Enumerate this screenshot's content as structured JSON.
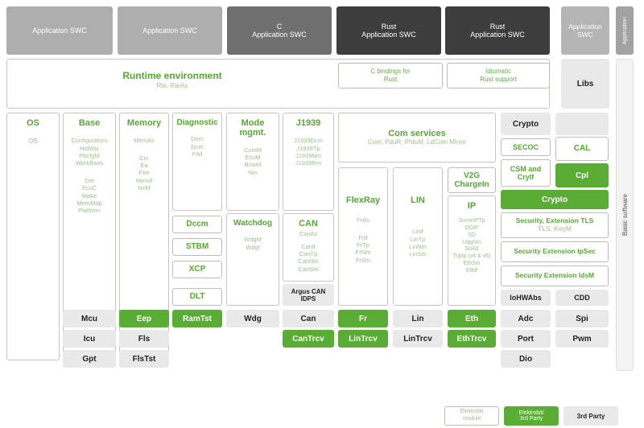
{
  "diagram": {
    "title": "Automotive software stack architecture",
    "colors": {
      "green": "#59ad34",
      "green_text": "#56a832",
      "grey_light": "#aeaeae",
      "grey_mid": "#6f6f6f",
      "grey_dark": "#3d3d3d",
      "panel_grey": "#e9e9e9"
    }
  },
  "application_layer": {
    "side_label": "Application",
    "swcs": [
      {
        "prefix": "",
        "label": "Application SWC",
        "tone": "light"
      },
      {
        "prefix": "",
        "label": "Application SWC",
        "tone": "light"
      },
      {
        "prefix": "C",
        "label": "Application SWC",
        "tone": "mid"
      },
      {
        "prefix": "Rust",
        "label": "Application SWC",
        "tone": "dark"
      },
      {
        "prefix": "Rust",
        "label": "Application SWC",
        "tone": "dark"
      },
      {
        "prefix": "",
        "label": "Application SWC",
        "tone": "small"
      }
    ]
  },
  "rte": {
    "title": "Runtime environment",
    "subtitle": "Rte, RteAs",
    "bindings": [
      {
        "line1": "C bindings for",
        "line2": "Rust"
      },
      {
        "line1": "Idiomatic",
        "line2": "Rust support"
      }
    ],
    "libs_label": "Libs"
  },
  "basic_software": {
    "side_label": "Basic software",
    "os": {
      "title": "OS",
      "items": [
        "OS"
      ]
    },
    "base": {
      "title": "Base",
      "group1": [
        "Configurators",
        "HidWiz",
        "PbcfgM",
        "Workflows"
      ],
      "group2": [
        "Det",
        "EcuC",
        "Make",
        "MemMap",
        "Platform"
      ]
    },
    "memory": {
      "title": "Memory",
      "group1": [
        "MemAs"
      ],
      "group2": [
        "Crc",
        "Ea",
        "Fee",
        "Memif",
        "NvM"
      ]
    },
    "diagnostic": {
      "title": "Diagnostic",
      "items": [
        "Dem",
        "Dcm",
        "FiM"
      ],
      "extras": [
        "Dccm",
        "STBM",
        "XCP",
        "DLT"
      ]
    },
    "mode_mgmt": {
      "title_line1": "Mode",
      "title_line2": "mgmt.",
      "items": [
        "ComM",
        "EcuM",
        "BswM",
        "Nm"
      ]
    },
    "watchdog": {
      "title": "Watchdog",
      "items": [
        "WdgM",
        "Wdgf"
      ]
    },
    "j1939": {
      "title": "J1939",
      "items": [
        "J1939Dcm",
        "J1939Tp",
        "J1939Nm",
        "J1939Rm"
      ]
    },
    "can": {
      "title": "CAN",
      "group1": [
        "CanAs"
      ],
      "group2": [
        "Canif",
        "CanTp",
        "CanNm",
        "CanSm"
      ],
      "footer_line1": "Argus CAN",
      "footer_line2": "IDPS"
    },
    "com_services": {
      "title": "Com services",
      "subtitle": "Com, PduR, IPduM, LdCom Mirror"
    },
    "flexray": {
      "title": "FlexRay",
      "group1": [
        "FrAs"
      ],
      "group2": [
        "Frif",
        "FrTp",
        "FrNm",
        "FrSm"
      ]
    },
    "lin": {
      "title": "LIN",
      "items": [
        "Linif",
        "LinTp",
        "LinNm",
        "LinSm"
      ]
    },
    "v2g": {
      "line1": "V2G",
      "line2": "ChargeIn"
    },
    "ip": {
      "title": "IP",
      "items": [
        "SomeIPTp",
        "DOIP",
        "SD",
        "UdpNm",
        "SoAd",
        "TcpIp (v4 & v6)",
        "EthSm",
        "Ethif"
      ]
    },
    "crypto_column": {
      "crypto_grey": "Crypto",
      "secoc": "SECOC",
      "csm_line1": "CSM and",
      "csm_line2": "CryIf",
      "cal": "CAL",
      "cpl": "Cpl",
      "crypto_green": "Crypto",
      "sec_tls_line1": "Security, Extension TLS",
      "sec_tls_line2": "TLS, KeyM",
      "sec_ipsec": "Security Extension IpSec",
      "sec_idsm": "Security Extension IdsM",
      "iohwabs": "IoHWAbs",
      "cdd": "CDD"
    },
    "drivers": {
      "col_mcu": [
        {
          "label": "Mcu",
          "tone": "grey"
        },
        {
          "label": "Icu",
          "tone": "grey"
        },
        {
          "label": "Gpt",
          "tone": "grey"
        }
      ],
      "col_mem": [
        {
          "label": "Eep",
          "tone": "green"
        },
        {
          "label": "Fls",
          "tone": "grey"
        },
        {
          "label": "FlsTst",
          "tone": "grey"
        }
      ],
      "col_ram": [
        {
          "label": "RamTst",
          "tone": "green"
        }
      ],
      "col_wdg": [
        {
          "label": "Wdg",
          "tone": "grey"
        }
      ],
      "col_can": [
        {
          "label": "Can",
          "tone": "grey"
        },
        {
          "label": "CanTrcv",
          "tone": "green"
        }
      ],
      "col_fr": [
        {
          "label": "Fr",
          "tone": "green"
        },
        {
          "label": "LinTrcv",
          "tone": "green"
        }
      ],
      "col_lin": [
        {
          "label": "Lin",
          "tone": "grey"
        },
        {
          "label": "LinTrcv",
          "tone": "grey"
        }
      ],
      "col_eth": [
        {
          "label": "Eth",
          "tone": "green"
        },
        {
          "label": "EthTrcv",
          "tone": "green"
        }
      ],
      "col_io": [
        {
          "label": "Adc",
          "tone": "grey"
        },
        {
          "label": "Port",
          "tone": "grey"
        },
        {
          "label": "Dio",
          "tone": "grey"
        }
      ],
      "col_spi": [
        {
          "label": "Spi",
          "tone": "grey"
        },
        {
          "label": "Pwm",
          "tone": "grey"
        }
      ]
    }
  },
  "legend": [
    {
      "line1": "Elektrobit",
      "line2": "module",
      "style": "white"
    },
    {
      "line1": "Elektrobit/",
      "line2": "3rd Party",
      "style": "green"
    },
    {
      "line1": "3rd Party",
      "line2": "",
      "style": "grey"
    }
  ]
}
